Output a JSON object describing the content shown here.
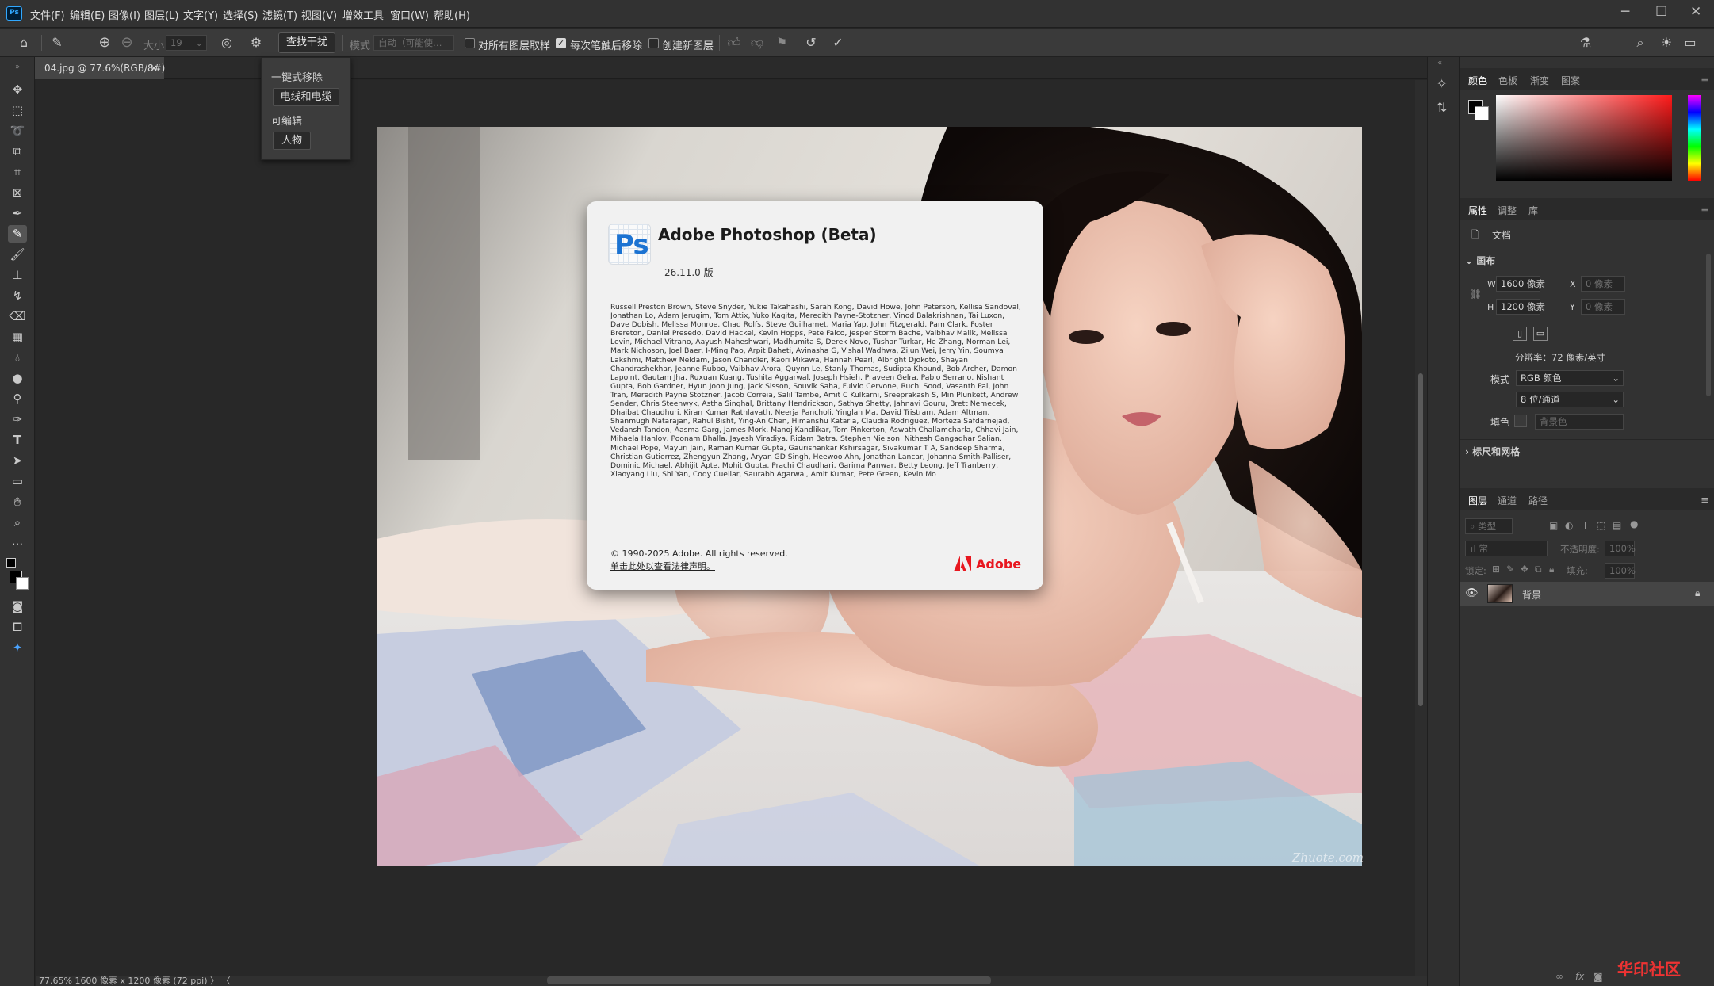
{
  "menubar": {
    "app_icon": "Ps",
    "items": [
      "文件(F)",
      "编辑(E)",
      "图像(I)",
      "图层(L)",
      "文字(Y)",
      "选择(S)",
      "滤镜(T)",
      "视图(V)",
      "增效工具",
      "窗口(W)",
      "帮助(H)"
    ],
    "window_controls": [
      "minimize-icon",
      "maximize-icon",
      "close-icon"
    ]
  },
  "options": {
    "size_label": "大小",
    "size_value": "19",
    "find_distractions_label": "查找干扰",
    "mode_label": "模式",
    "mode_value": "自动（可能使…",
    "sample_all_layers_label": "对所有图层取样",
    "sample_all_layers_checked": false,
    "remove_after_stroke_label": "每次笔触后移除",
    "remove_after_stroke_checked": true,
    "new_layer_label": "创建新图层",
    "new_layer_checked": false
  },
  "dropdown": {
    "section1_title": "一键式移除",
    "section1_button": "电线和电缆",
    "section2_title": "可编辑",
    "section2_button": "人物"
  },
  "document": {
    "tab_label": "04.jpg @ 77.6%(RGB/8#)",
    "tab_close": "×",
    "watermark": "Zhuote.com"
  },
  "about": {
    "logo_text": "Ps",
    "title": "Adobe Photoshop (Beta)",
    "version": "26.11.0 版",
    "credits": "Russell Preston Brown, Steve Snyder, Yukie Takahashi, Sarah Kong, David Howe, John Peterson, Kellisa Sandoval, Jonathan Lo, Adam Jerugim, Tom Attix, Yuko Kagita, Meredith Payne-Stotzner, Vinod Balakrishnan, Tai Luxon, Dave Dobish, Melissa Monroe, Chad Rolfs, Steve Guilhamet, Maria Yap, John Fitzgerald, Pam Clark, Foster Brereton, Daniel Presedo, David Hackel, Kevin Hopps, Pete Falco, Jesper Storm Bache, Vaibhav Malik, Melissa Levin, Michael Vitrano, Aayush Maheshwari, Madhumita S, Derek Novo, Tushar Turkar, He Zhang, Norman Lei, Mark Nichoson, Joel Baer, I-Ming Pao, Arpit Baheti, Avinasha G, Vishal Wadhwa, Zijun Wei, Jerry Yin, Soumya Lakshmi, Matthew Neldam, Jason Chandler, Kaori Mikawa, Hannah Pearl, Albright Djokoto, Shayan Chandrashekhar, Jeanne Rubbo, Vaibhav Arora, Quynn Le, Stanly Thomas, Sudipta Khound, Bob Archer, Damon Lapoint, Gautam Jha, Ruxuan Kuang, Tushita Aggarwal, Joseph Hsieh, Praveen Gelra, Pablo Serrano, Nishant Gupta, Bob Gardner, Hyun Joon Jung, Jack Sisson, Souvik Saha, Fulvio Cervone, Ruchi Sood, Vasanth Pai, John Tran, Meredith Payne Stotzner, Jacob Correia, Salil Tambe, Amit C Kulkarni, Sreeprakash S, Min Plunkett, Andrew Sender, Chris Steenwyk, Astha Singhal, Brittany Hendrickson, Sathya Shetty, Jahnavi Gouru, Brett Nemecek, Dhaibat Chaudhuri, Kiran Kumar Rathlavath, Neerja Pancholi, Yinglan Ma, David Tristram, Adam Altman, Shanmugh Natarajan, Rahul Bisht, Ying-An Chen, Himanshu Kataria, Claudia Rodriguez, Morteza Safdarnejad, Vedansh Tandon, Aasma Garg, James Mork, Manoj Kandlikar, Tom Pinkerton, Aswath Challamcharla, Chhavi Jain, Mihaela Hahlov, Poonam Bhalla, Jayesh Viradiya, Ridam Batra, Stephen Nielson, Nithesh Gangadhar Salian, Michael Pope, Mayuri Jain, Raman Kumar Gupta, Gaurishankar Kshirsagar, Sivakumar T A, Sandeep Sharma, Christian Gutierrez, Zhengyun Zhang, Aryan GD Singh, Heewoo Ahn, Jonathan Lancar, Johanna Smith-Palliser, Dominic Michael, Abhijit Apte, Mohit Gupta, Prachi Chaudhari, Garima Panwar, Betty Leong, Jeff Tranberry, Xiaoyang Liu, Shi Yan, Cody Cuellar, Saurabh Agarwal, Amit Kumar, Pete Green, Kevin Mo",
    "copyright": "© 1990-2025 Adobe. All rights reserved.",
    "legal_link": "单击此处以查看法律声明。",
    "brand": "Adobe"
  },
  "status": {
    "text": "77.65%   1600 像素 x 1200 像素 (72 ppi)   〉  〈"
  },
  "color_panel": {
    "tabs": [
      "颜色",
      "色板",
      "渐变",
      "图案"
    ],
    "foreground": "#000000",
    "background": "#ffffff"
  },
  "properties": {
    "tabs": [
      "属性",
      "调整",
      "库"
    ],
    "doc_label": "文档",
    "canvas_section": "画布",
    "w_label": "W",
    "w_value": "1600 像素",
    "h_label": "H",
    "h_value": "1200 像素",
    "x_label": "X",
    "x_placeholder": "0 像素",
    "y_label": "Y",
    "y_placeholder": "0 像素",
    "resolution": "分辨率：72 像素/英寸",
    "mode_label": "模式",
    "mode_value": "RGB 颜色",
    "depth_value": "8 位/通道",
    "fill_label": "填色",
    "fill_value": "背景色",
    "rulers_section": "标尺和网格"
  },
  "layers": {
    "tabs": [
      "图层",
      "通道",
      "路径"
    ],
    "search_placeholder": "类型",
    "blend_mode": "正常",
    "opacity_label": "不透明度:",
    "opacity_value": "100%",
    "lock_label": "锁定:",
    "fill_label": "填充:",
    "fill_value": "100%",
    "layer_name": "背景",
    "footer_fx": "fx"
  },
  "corner_badge": "华印社区"
}
